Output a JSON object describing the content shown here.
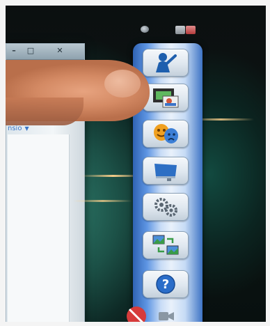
{
  "window": {
    "minimize_glyph": "–",
    "maximize_glyph": "□",
    "close_glyph": "✕",
    "partial_text": "nsio",
    "dropdown_caret": "▼"
  },
  "toolbar": {
    "buttons": [
      {
        "icon": "user-present-icon"
      },
      {
        "icon": "filmstrip-slides-icon"
      },
      {
        "icon": "theater-masks-icon"
      },
      {
        "icon": "projector-screen-icon"
      },
      {
        "icon": "gears-icon"
      },
      {
        "icon": "image-swap-icon"
      },
      {
        "icon": "help-icon",
        "glyph": "?"
      }
    ],
    "bottom_icons": [
      "presentation-off-icon",
      "video-camera-icon"
    ]
  },
  "colors": {
    "toolbar_blue": "#3d73c4",
    "help_blue": "#2a6dc9",
    "close_red": "#b33c3c"
  }
}
